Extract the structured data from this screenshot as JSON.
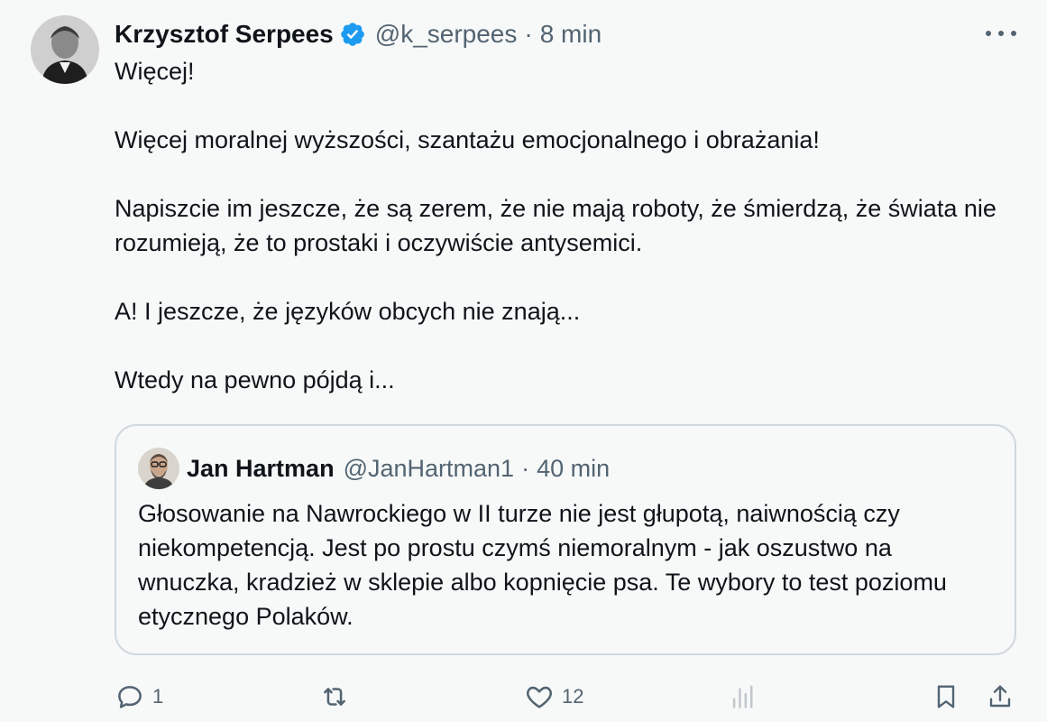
{
  "tweet": {
    "author_name": "Krzysztof Serpees",
    "handle": "@k_serpees",
    "separator": "·",
    "time": "8 min",
    "paragraphs": [
      "Więcej!",
      "Więcej moralnej wyższości, szantażu emocjonalnego i obrażania!",
      "Napiszcie im jeszcze, że są zerem, że nie mają roboty, że śmierdzą, że świata nie rozumieją, że to prostaki i oczywiście antysemici.",
      "A! I jeszcze, że języków obcych nie znają...",
      "Wtedy na pewno pójdą i..."
    ]
  },
  "quote": {
    "author_name": "Jan Hartman",
    "handle": "@JanHartman1",
    "separator": "·",
    "time": "40 min",
    "text": "Głosowanie na Nawrockiego w II turze nie jest głupotą, naiwnością czy niekompetencją. Jest po prostu czymś niemoralnym - jak oszustwo na wnuczka, kradzież w sklepie albo kopnięcie psa. Te wybory to test poziomu etycznego Polaków."
  },
  "actions": {
    "reply_count": "1",
    "retweet_count": "",
    "like_count": "12",
    "views_count": ""
  },
  "icons": {
    "verified": "verified-badge-icon",
    "more": "more-options-icon",
    "reply": "reply-icon",
    "retweet": "retweet-icon",
    "like": "heart-icon",
    "views": "views-chart-icon",
    "bookmark": "bookmark-icon",
    "share": "share-icon"
  },
  "colors": {
    "verified_blue": "#1d9bf0",
    "text_primary": "#0f1419",
    "text_secondary": "#536471",
    "border": "#cfd9de",
    "background": "#f7f9f9"
  }
}
